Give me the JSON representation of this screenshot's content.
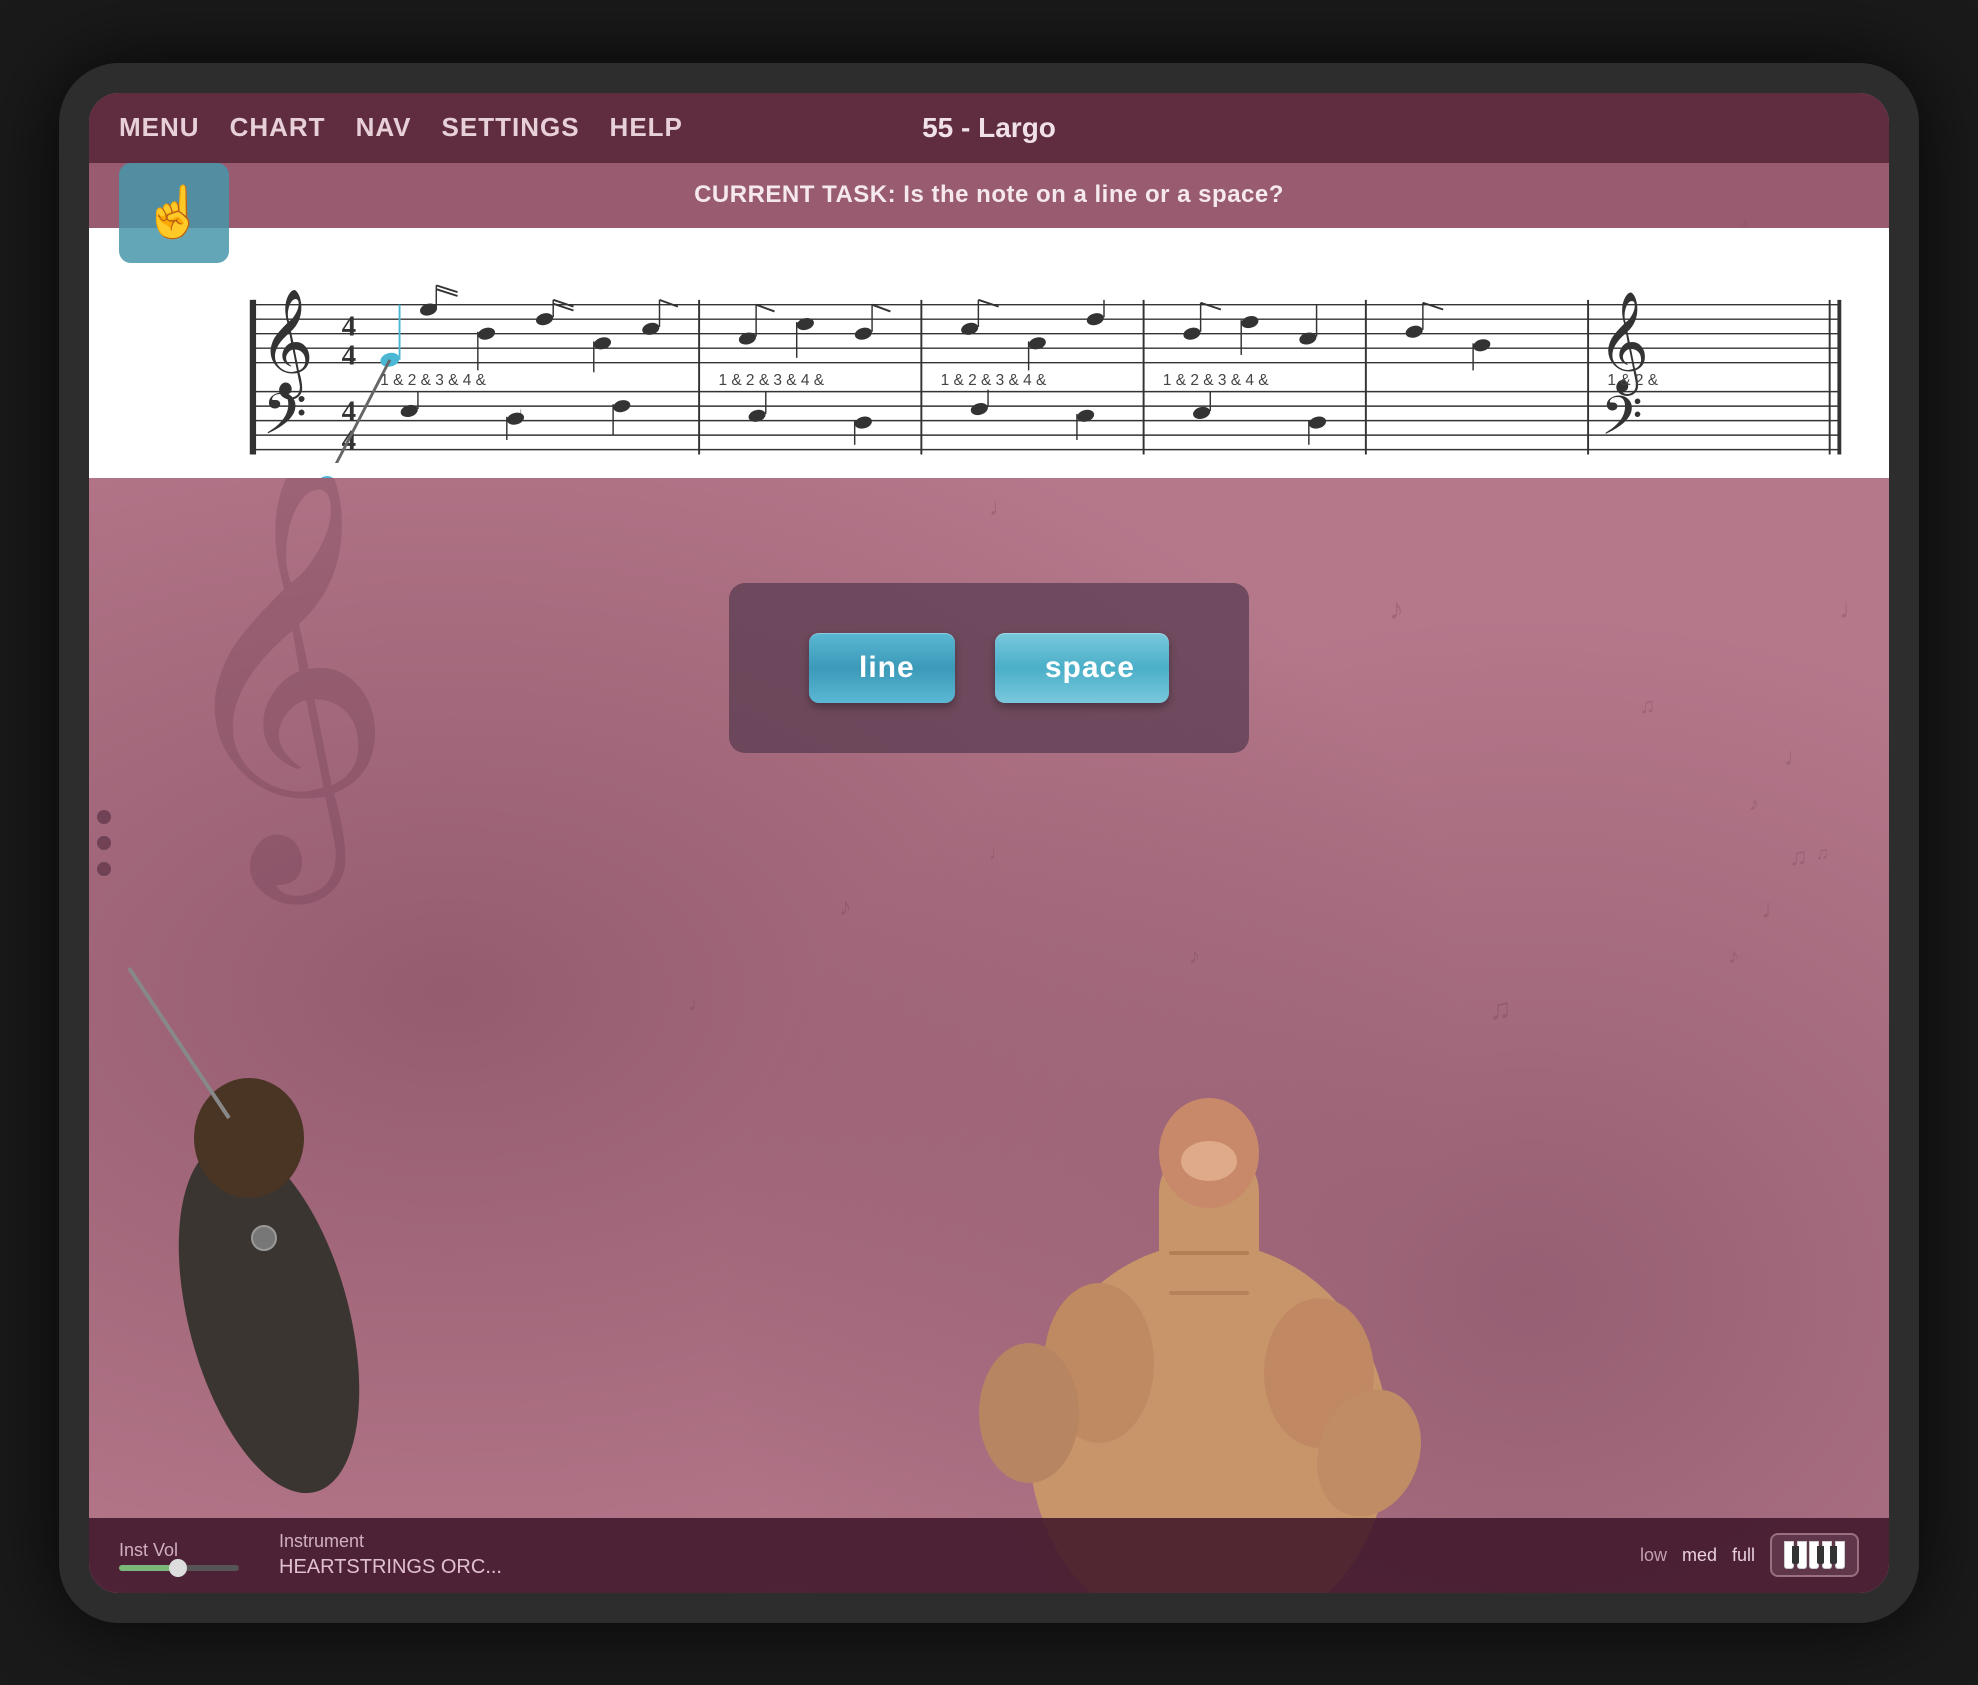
{
  "app": {
    "title": "55 - Largo"
  },
  "nav": {
    "items": [
      "MENU",
      "CHART",
      "NAV",
      "SETTINGS",
      "HELP"
    ]
  },
  "task": {
    "text": "CURRENT TASK: Is the note on a line or a space?"
  },
  "answers": {
    "line_label": "line",
    "space_label": "space"
  },
  "bottom_bar": {
    "inst_vol_label": "Inst Vol",
    "instrument_label": "Instrument",
    "instrument_name": "HEARTSTRINGS ORC...",
    "volume_options": [
      "low",
      "med",
      "full"
    ],
    "volume_active": "full"
  },
  "sheet_music": {
    "time_signature": "4/4",
    "beat_markers": [
      "1 & 2 & 3 & 4 &",
      "1 & 2 & 3 & 4 &",
      "1 & 2 & 3 & 4 &",
      "1 & 2 & 3 & 4 &",
      "1 & 2 &"
    ]
  },
  "icons": {
    "touch_icon": "☝",
    "treble_clef": "𝄞",
    "bass_clef": "𝄢",
    "keyboard": "⌨"
  }
}
